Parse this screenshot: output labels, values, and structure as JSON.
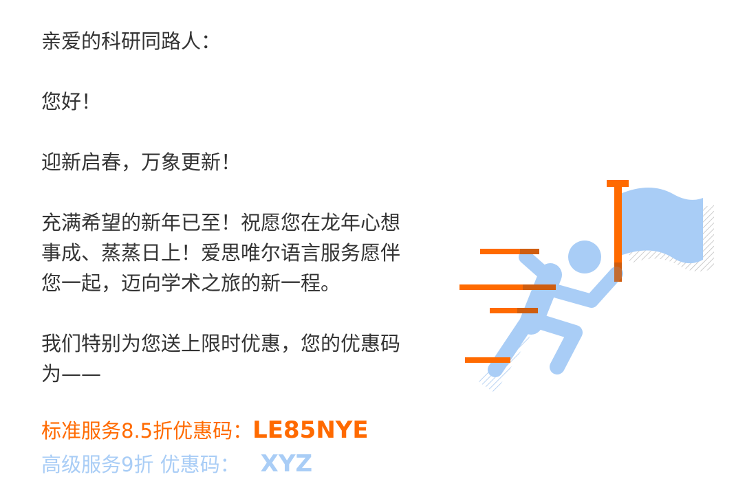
{
  "letter": {
    "greeting": "亲爱的科研同路人：",
    "hello": "您好！",
    "intro": "迎新启春，万象更新！",
    "wish_lines": [
      "充满希望的新年已至！祝愿您在龙年心想",
      "事成、蒸蒸日上！爱思唯尔语言服务愿伴",
      "您一起，迈向学术之旅的新一程。"
    ],
    "offer_lines": [
      "我们特别为您送上限时优惠，您的优惠码",
      "为——"
    ]
  },
  "promos": {
    "standard": {
      "label": "标准服务8.5折优惠码：",
      "code": "LE85NYE",
      "color": "#ff6a00"
    },
    "advanced": {
      "label": "高级服务9折 优惠码：",
      "code": "XYZ",
      "color": "#a9cdf6"
    }
  },
  "illustration": {
    "icon": "running-person-with-flag-icon",
    "colors": {
      "orange": "#ff6a00",
      "blue": "#a9cdf6",
      "hatch": "#bdbdbd"
    }
  }
}
